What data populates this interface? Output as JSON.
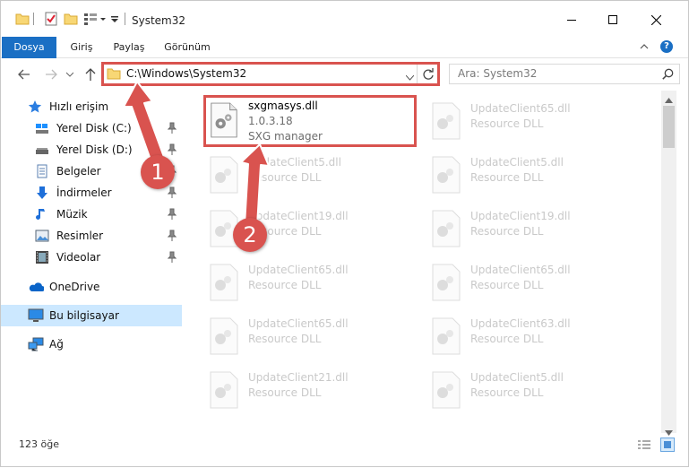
{
  "window": {
    "title": "System32"
  },
  "ribbon": {
    "tabs": [
      "Dosya",
      "Giriş",
      "Paylaş",
      "Görünüm"
    ]
  },
  "address": {
    "path": "C:\\Windows\\System32"
  },
  "search": {
    "placeholder": "Ara: System32"
  },
  "sidebar": {
    "items": [
      {
        "label": "Hızlı erişim",
        "icon": "star-icon"
      },
      {
        "label": "Yerel Disk (C:)",
        "icon": "drive-icon",
        "pinned": true
      },
      {
        "label": "Yerel Disk (D:)",
        "icon": "drive-icon",
        "pinned": true
      },
      {
        "label": "Belgeler",
        "icon": "documents-icon",
        "pinned": true
      },
      {
        "label": "İndirmeler",
        "icon": "download-icon",
        "pinned": true
      },
      {
        "label": "Müzik",
        "icon": "music-icon",
        "pinned": true
      },
      {
        "label": "Resimler",
        "icon": "pictures-icon",
        "pinned": true
      },
      {
        "label": "Videolar",
        "icon": "videos-icon",
        "pinned": true
      },
      {
        "label": "OneDrive",
        "icon": "onedrive-icon"
      },
      {
        "label": "Bu bilgisayar",
        "icon": "computer-icon",
        "selected": true
      },
      {
        "label": "Ağ",
        "icon": "network-icon"
      }
    ]
  },
  "files": {
    "highlighted": {
      "name": "sxgmasys.dll",
      "version": "1.0.3.18",
      "description": "SXG manager"
    },
    "col1": [
      {
        "name": "UpdateClient5.dll",
        "description": "Resource DLL"
      },
      {
        "name": "UpdateClient19.dll",
        "description": "Resource DLL"
      },
      {
        "name": "UpdateClient65.dll",
        "description": "Resource DLL"
      },
      {
        "name": "UpdateClient65.dll",
        "description": "Resource DLL"
      },
      {
        "name": "UpdateClient21.dll",
        "description": "Resource DLL"
      }
    ],
    "col2": [
      {
        "name": "UpdateClient65.dll",
        "description": "Resource DLL"
      },
      {
        "name": "UpdateClient5.dll",
        "description": "Resource DLL"
      },
      {
        "name": "UpdateClient19.dll",
        "description": "Resource DLL"
      },
      {
        "name": "UpdateClient65.dll",
        "description": "Resource DLL"
      },
      {
        "name": "UpdateClient63.dll",
        "description": "Resource DLL"
      },
      {
        "name": "UpdateClient5.dll",
        "description": "Resource DLL"
      }
    ]
  },
  "annotations": {
    "step1": "1",
    "step2": "2"
  },
  "status": {
    "count": "123 öğe"
  },
  "colors": {
    "accent": "#1a6fc4",
    "highlight": "#d9534f",
    "selected_nav": "#cce8ff"
  }
}
